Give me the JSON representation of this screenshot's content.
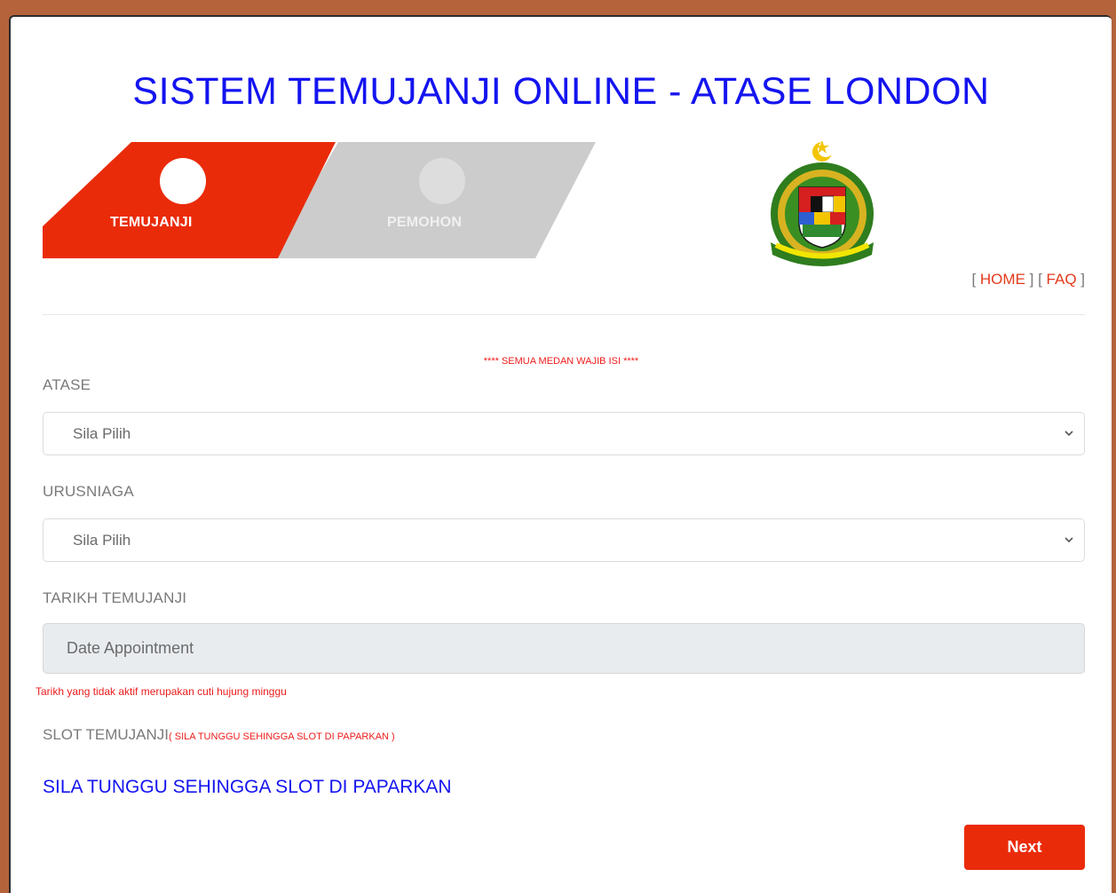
{
  "header": {
    "title": "SISTEM TEMUJANJI ONLINE - ATASE LONDON"
  },
  "steps": [
    {
      "label": "TEMUJANJI",
      "active": true
    },
    {
      "label": "PEMOHON",
      "active": false
    }
  ],
  "emblem": {
    "text": "IMIGRESEN MALAYSIA"
  },
  "nav": {
    "open1": "[ ",
    "home": "HOME",
    "sep": " ] [ ",
    "faq": "FAQ",
    "close": " ]"
  },
  "form": {
    "required_note": "**** SEMUA MEDAN WAJIB ISI ****",
    "atase": {
      "label": "ATASE",
      "value": "Sila Pilih"
    },
    "urusniaga": {
      "label": "URUSNIAGA",
      "value": "Sila Pilih"
    },
    "tarikh": {
      "label": "TARIKH TEMUJANJI",
      "placeholder": "Date Appointment",
      "hint": "Tarikh yang tidak aktif merupakan cuti hujung minggu"
    },
    "slot": {
      "label": "SLOT TEMUJANJI",
      "note": "( SILA TUNGGU SEHINGGA SLOT DI PAPARKAN )",
      "waiting": "SILA TUNGGU SEHINGGA SLOT DI PAPARKAN"
    },
    "next_label": "Next"
  },
  "colors": {
    "background": "#b4633b",
    "accent": "#ea2b0a",
    "title": "#1414f0",
    "inactive_step": "#cccccc",
    "warning_text": "#ec1c1c"
  }
}
